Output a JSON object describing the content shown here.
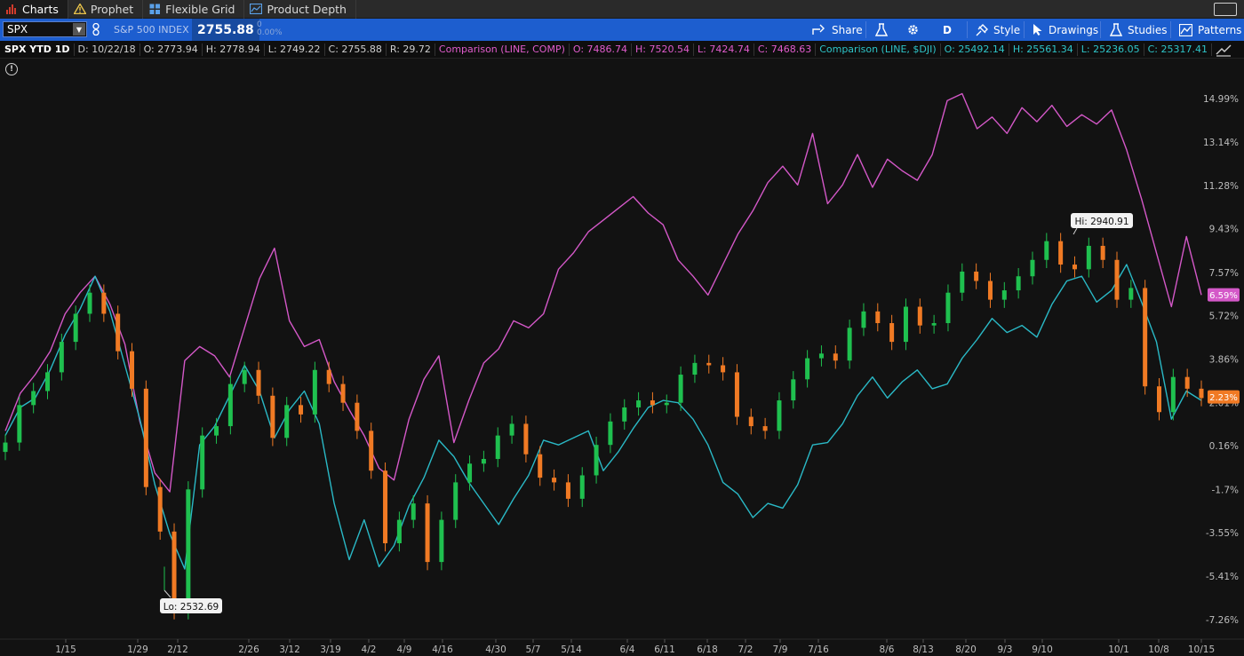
{
  "tabs": [
    {
      "label": "Charts",
      "icon": "bar-chart-icon",
      "active": true
    },
    {
      "label": "Prophet",
      "icon": "warning-triangle-icon",
      "active": false
    },
    {
      "label": "Flexible Grid",
      "icon": "grid-icon",
      "active": false
    },
    {
      "label": "Product Depth",
      "icon": "depth-chart-icon",
      "active": false
    }
  ],
  "toolbar": {
    "symbol": "SPX",
    "description": "S&P 500 INDEX",
    "last_price": "2755.88",
    "change": "0",
    "change_pct": "0.00%",
    "share_label": "Share",
    "period_label": "D",
    "style_label": "Style",
    "drawings_label": "Drawings",
    "studies_label": "Studies",
    "patterns_label": "Patterns"
  },
  "infoline": {
    "symbol_period": "SPX YTD 1D",
    "date": "D: 10/22/18",
    "open": "O: 2773.94",
    "high": "H: 2778.94",
    "low": "L: 2749.22",
    "close": "C: 2755.88",
    "range": "R: 29.72",
    "comp_label": "Comparison (LINE, COMP)",
    "comp_open": "O: 7486.74",
    "comp_high": "H: 7520.54",
    "comp_low": "L: 7424.74",
    "comp_close": "C: 7468.63",
    "dji_label": "Comparison (LINE, $DJI)",
    "dji_open": "O: 25492.14",
    "dji_high": "H: 25561.34",
    "dji_low": "L: 25236.05",
    "dji_close": "C: 25317.41"
  },
  "colors": {
    "up": "#1fc04f",
    "down": "#f07a24",
    "comp": "#d458c8",
    "dji": "#2ab9c6",
    "toolbar": "#1d5ecf"
  },
  "chart_data": {
    "type": "line",
    "x_ticks": [
      "1/15",
      "1/29",
      "2/12",
      "2/26",
      "3/12",
      "3/19",
      "4/2",
      "4/9",
      "4/16",
      "4/30",
      "5/7",
      "5/14",
      "6/4",
      "6/11",
      "6/18",
      "7/2",
      "7/9",
      "7/16",
      "8/6",
      "8/13",
      "8/20",
      "9/3",
      "9/10",
      "10/1",
      "10/8",
      "10/15"
    ],
    "y_ticks": [
      "14.99%",
      "13.14%",
      "11.28%",
      "9.43%",
      "7.57%",
      "5.72%",
      "3.86%",
      "2.01%",
      "0.16%",
      "-1.7%",
      "-3.55%",
      "-5.41%",
      "-7.26%"
    ],
    "hi_label": "Hi: 2940.91",
    "lo_label": "Lo: 2532.69",
    "comp_last_label": "6.59%",
    "spx_last_label": "2.23%",
    "series": [
      {
        "name": "SPX",
        "values": [
          0.3,
          1.9,
          2.5,
          3.3,
          4.6,
          5.8,
          6.7,
          5.8,
          4.2,
          2.6,
          -1.6,
          -3.5,
          -6.9,
          -1.7,
          0.6,
          1.0,
          2.8,
          3.4,
          2.3,
          0.5,
          1.9,
          1.5,
          3.4,
          2.8,
          2.0,
          0.8,
          -0.9,
          -4.0,
          -3.0,
          -2.3,
          -4.8,
          -3.0,
          -1.4,
          -0.6,
          -0.4,
          0.6,
          1.1,
          -0.2,
          -1.2,
          -1.4,
          -2.1,
          -1.1,
          0.2,
          1.2,
          1.8,
          2.1,
          1.9,
          2.0,
          3.2,
          3.7,
          3.6,
          3.3,
          1.4,
          1.0,
          0.8,
          2.1,
          3.0,
          3.9,
          4.1,
          3.8,
          5.2,
          5.9,
          5.4,
          4.6,
          6.1,
          5.3,
          5.4,
          6.7,
          7.6,
          7.2,
          6.4,
          6.8,
          7.4,
          8.1,
          8.9,
          7.9,
          7.7,
          8.7,
          8.1,
          6.4,
          6.9,
          2.7,
          1.6,
          3.1,
          2.6,
          2.2
        ]
      },
      {
        "name": "COMP",
        "values": [
          0.8,
          2.4,
          3.2,
          4.2,
          5.8,
          6.7,
          7.4,
          6.2,
          4.5,
          1.2,
          -1.0,
          -1.8,
          3.8,
          4.4,
          4.0,
          3.1,
          5.2,
          7.3,
          8.6,
          5.5,
          4.4,
          4.7,
          2.9,
          1.7,
          0.6,
          -0.8,
          -1.3,
          1.3,
          3.0,
          4.0,
          0.3,
          2.1,
          3.7,
          4.3,
          5.5,
          5.2,
          5.8,
          7.7,
          8.4,
          9.3,
          9.8,
          10.3,
          10.8,
          10.1,
          9.6,
          8.1,
          7.4,
          6.6,
          7.9,
          9.2,
          10.2,
          11.4,
          12.1,
          11.3,
          13.5,
          10.5,
          11.3,
          12.6,
          11.2,
          12.4,
          11.9,
          11.5,
          12.6,
          14.9,
          15.2,
          13.7,
          14.2,
          13.5,
          14.6,
          14.0,
          14.7,
          13.8,
          14.3,
          13.9,
          14.5,
          12.8,
          10.7,
          8.4,
          6.1,
          9.1,
          6.6
        ]
      },
      {
        "name": "$DJI",
        "values": [
          0.6,
          1.8,
          2.2,
          3.4,
          4.9,
          6.0,
          7.4,
          5.9,
          3.6,
          1.3,
          -1.5,
          -3.6,
          -5.1,
          0.2,
          1.0,
          2.3,
          3.6,
          2.5,
          0.5,
          1.7,
          2.5,
          1.1,
          -2.3,
          -4.7,
          -3.0,
          -5.0,
          -4.1,
          -2.4,
          -1.2,
          0.4,
          -0.3,
          -1.4,
          -2.3,
          -3.2,
          -2.1,
          -1.1,
          0.4,
          0.2,
          0.5,
          0.8,
          -0.9,
          -0.1,
          0.9,
          1.8,
          2.1,
          2.0,
          1.3,
          0.2,
          -1.4,
          -1.9,
          -2.9,
          -2.3,
          -2.5,
          -1.5,
          0.2,
          0.3,
          1.1,
          2.3,
          3.1,
          2.2,
          2.9,
          3.4,
          2.6,
          2.8,
          3.9,
          4.7,
          5.6,
          5.0,
          5.3,
          4.8,
          6.2,
          7.2,
          7.4,
          6.3,
          6.8,
          7.9,
          6.3,
          4.6,
          1.3,
          2.5,
          2.1
        ]
      }
    ]
  }
}
